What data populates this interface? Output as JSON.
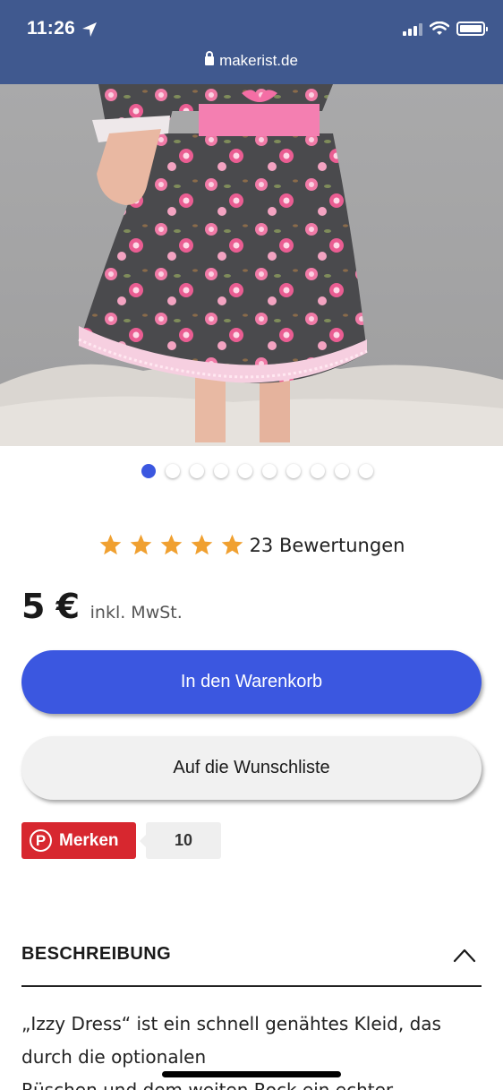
{
  "status_bar": {
    "time": "11:26",
    "url": "makerist.de"
  },
  "carousel": {
    "image_alt": "Child wearing grey dress with pink floral print and pink waistband",
    "total_dots": 10,
    "active_index": 0
  },
  "rating": {
    "stars": 5,
    "max_stars": 5,
    "label": "23 Bewertungen"
  },
  "price": {
    "value": "5 €",
    "note": "inkl. MwSt."
  },
  "buttons": {
    "add_to_cart": "In den Warenkorb",
    "wishlist": "Auf die Wunschliste"
  },
  "pinterest": {
    "label": "Merken",
    "count": "10"
  },
  "description": {
    "title": "BESCHREIBUNG",
    "lines": [
      "„Izzy Dress“ ist ein schnell genähtes Kleid, das",
      "durch die optionalen",
      "Rüschen und dem weiten Rock ein echter"
    ]
  },
  "colors": {
    "top_bar": "#40598f",
    "primary": "#3b57e0",
    "star": "#f0a030",
    "pinterest": "#d7272f"
  }
}
